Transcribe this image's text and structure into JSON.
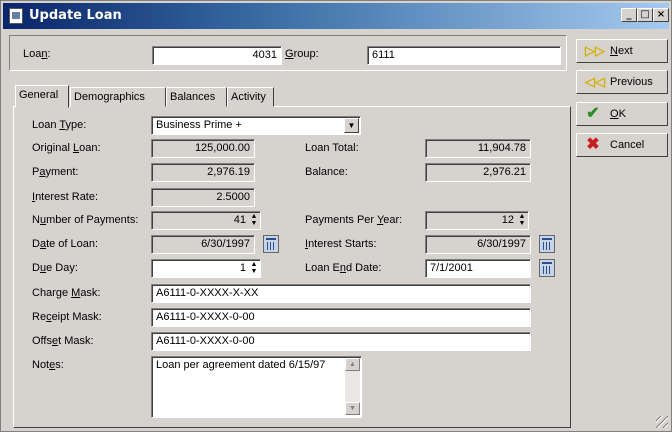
{
  "window": {
    "title": "Update Loan",
    "min_label": "_",
    "max_label": "□",
    "close_label": "×"
  },
  "header": {
    "loan_label_pre": "Loa",
    "loan_label_acc": "n",
    "loan_label_post": ":",
    "loan_value": "4031",
    "group_label_pre": "",
    "group_label_acc": "G",
    "group_label_post": "roup:",
    "group_value": "6111"
  },
  "tabs": [
    "General",
    "Demographics",
    "Balances",
    "Activity"
  ],
  "general": {
    "loan_type_label_pre": "Loan ",
    "loan_type_label_acc": "T",
    "loan_type_label_post": "ype:",
    "loan_type_value": "Business Prime +",
    "original_loan_label_pre": "Original ",
    "original_loan_label_acc": "L",
    "original_loan_label_post": "oan:",
    "original_loan_value": "125,000.00",
    "loan_total_label": "Loan Total:",
    "loan_total_value": "11,904.78",
    "payment_label_pre": "P",
    "payment_label_acc": "a",
    "payment_label_post": "yment:",
    "payment_value": "2,976.19",
    "balance_label": "Balance:",
    "balance_value": "2,976.21",
    "interest_rate_label_pre": "",
    "interest_rate_label_acc": "I",
    "interest_rate_label_post": "nterest Rate:",
    "interest_rate_value": "2.5000",
    "num_payments_label_pre": "N",
    "num_payments_label_acc": "u",
    "num_payments_label_post": "mber of Payments:",
    "num_payments_value": "41",
    "payments_per_year_label_pre": "Payments Per ",
    "payments_per_year_label_acc": "Y",
    "payments_per_year_label_post": "ear:",
    "payments_per_year_value": "12",
    "date_of_loan_label_pre": "D",
    "date_of_loan_label_acc": "a",
    "date_of_loan_label_post": "te of Loan:",
    "date_of_loan_value": "6/30/1997",
    "interest_starts_label_pre": "",
    "interest_starts_label_acc": "I",
    "interest_starts_label_post": "nterest Starts:",
    "interest_starts_value": "6/30/1997",
    "due_day_label_pre": "D",
    "due_day_label_acc": "u",
    "due_day_label_post": "e Day:",
    "due_day_value": "1",
    "loan_end_label_pre": "Loan E",
    "loan_end_label_acc": "n",
    "loan_end_label_post": "d Date:",
    "loan_end_value": "7/1/2001",
    "charge_mask_label_pre": "Charge ",
    "charge_mask_label_acc": "M",
    "charge_mask_label_post": "ask:",
    "charge_mask_value": "A6111-0-XXXX-X-XX",
    "receipt_mask_label_pre": "Re",
    "receipt_mask_label_acc": "c",
    "receipt_mask_label_post": "eipt Mask:",
    "receipt_mask_value": "A6111-0-XXXX-0-00",
    "offset_mask_label_pre": "Offs",
    "offset_mask_label_acc": "e",
    "offset_mask_label_post": "t Mask:",
    "offset_mask_value": "A6111-0-XXXX-0-00",
    "notes_label_pre": "Not",
    "notes_label_acc": "e",
    "notes_label_post": "s:",
    "notes_value": "Loan per agreement dated 6/15/97"
  },
  "buttons": {
    "next_pre": "",
    "next_acc": "N",
    "next_post": "ext",
    "previous_label": "Previous",
    "ok_pre": "",
    "ok_acc": "O",
    "ok_post": "K",
    "cancel_label": "Cancel"
  },
  "colors": {
    "title_start": "#0a246a",
    "title_end": "#a6caf0",
    "face": "#d6d3ce",
    "ok_check": "#2e8b22",
    "cancel_x": "#c81e1e",
    "nav_arrow": "#d4b000"
  }
}
